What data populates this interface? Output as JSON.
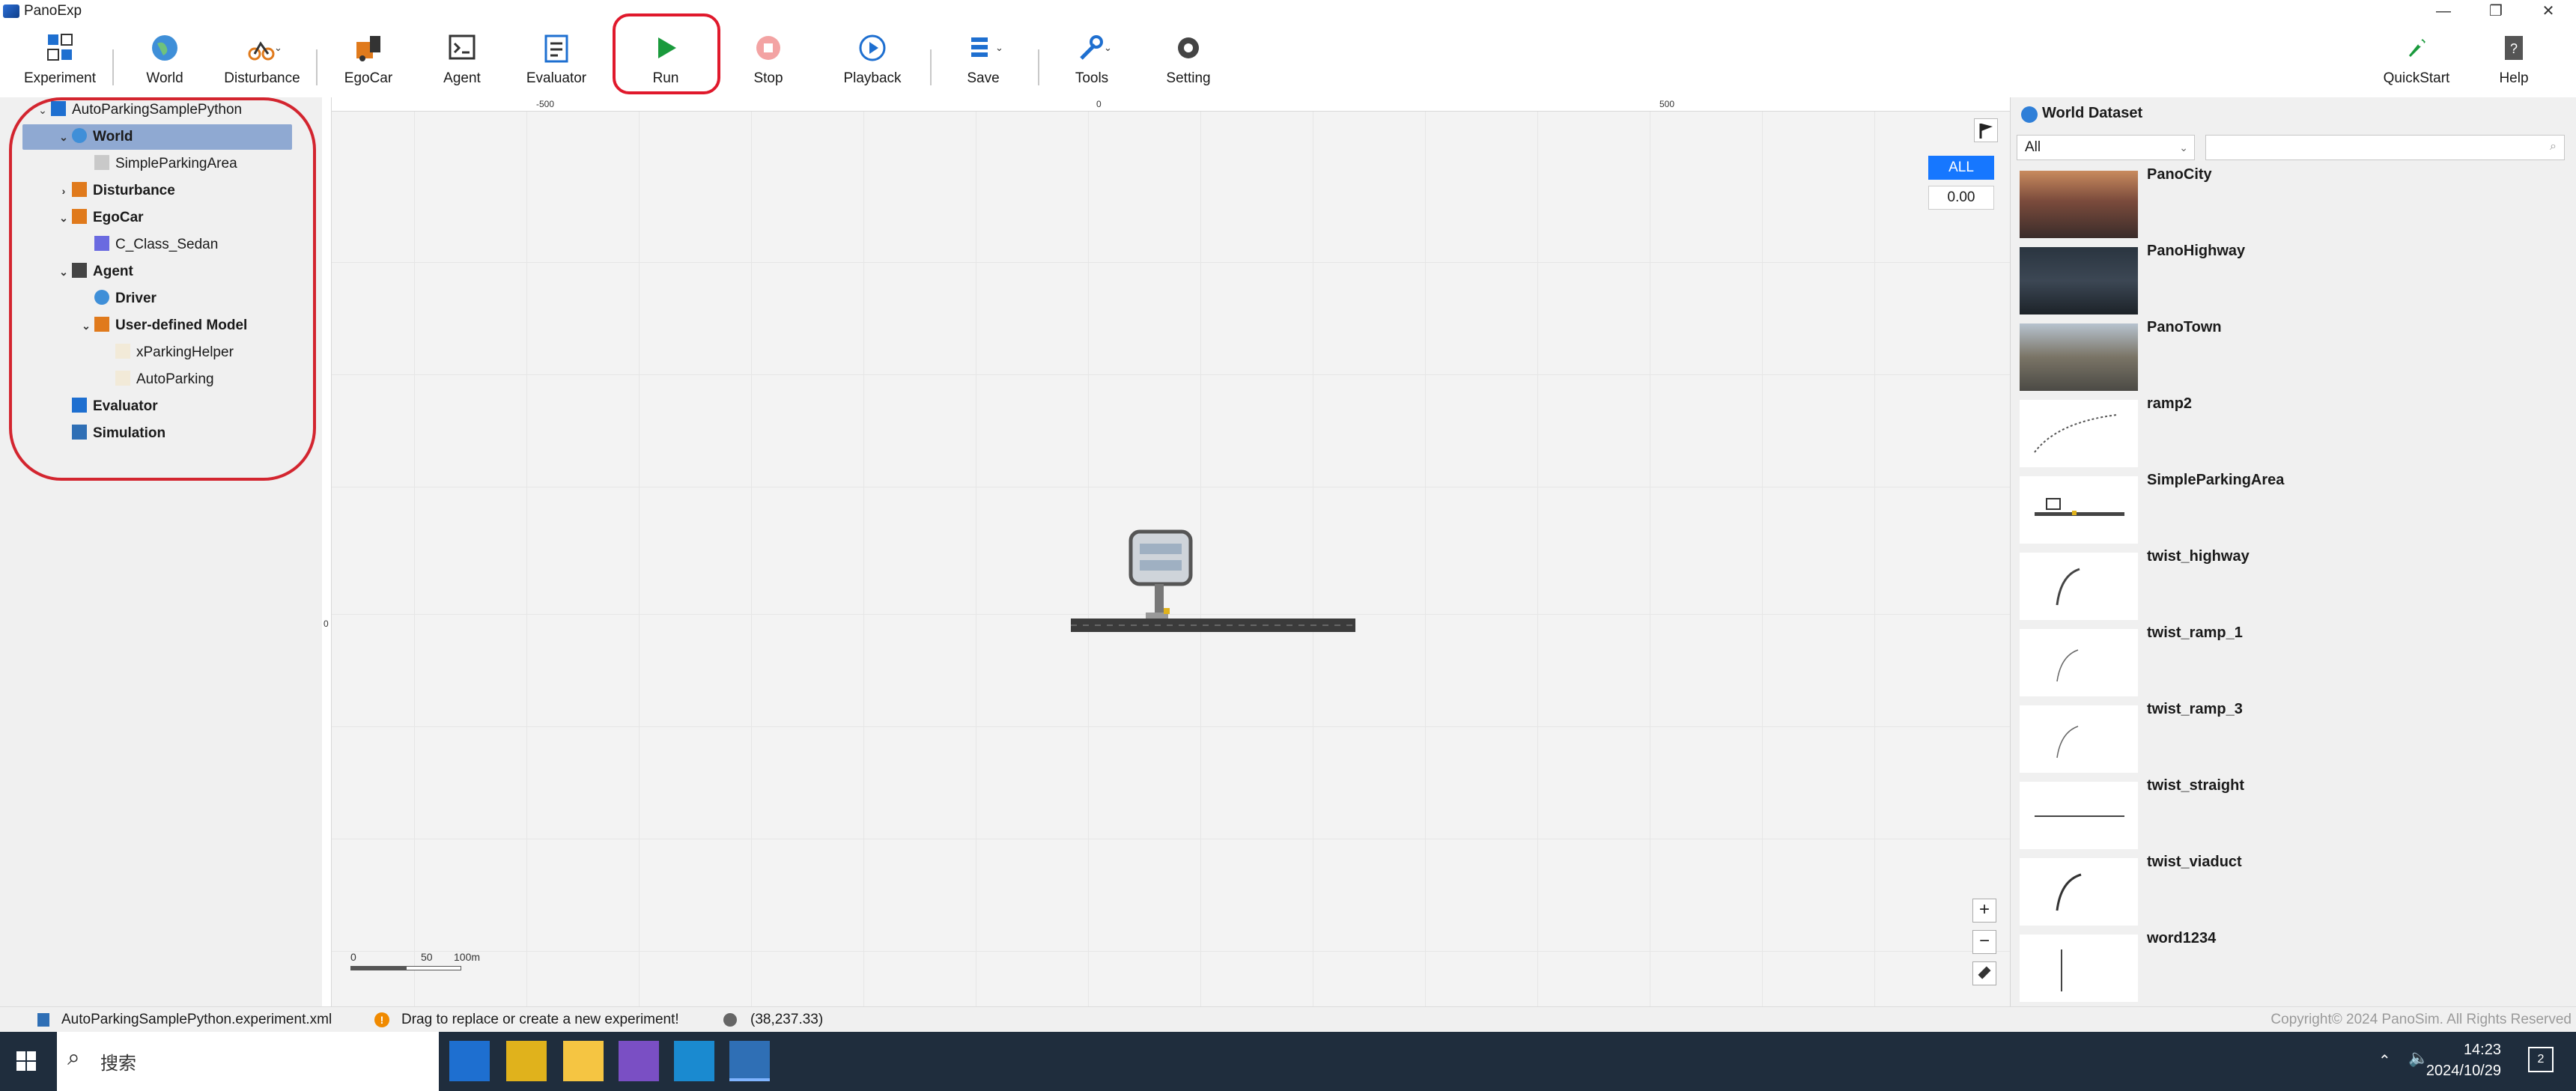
{
  "window": {
    "title": "PanoExp",
    "minimize": "—",
    "restore": "❐",
    "close": "✕"
  },
  "toolbar": {
    "experiment": "Experiment",
    "world": "World",
    "disturbance": "Disturbance",
    "egocar": "EgoCar",
    "agent": "Agent",
    "evaluator": "Evaluator",
    "run": "Run",
    "stop": "Stop",
    "playback": "Playback",
    "save": "Save",
    "tools": "Tools",
    "setting": "Setting",
    "quickstart": "QuickStart",
    "help": "Help",
    "highlight_color": "#e0192c"
  },
  "tree": {
    "root": "AutoParkingSamplePython",
    "world": "World",
    "world_child": "SimpleParkingArea",
    "disturbance": "Disturbance",
    "egocar": "EgoCar",
    "egocar_child": "C_Class_Sedan",
    "agent": "Agent",
    "driver": "Driver",
    "udm": "User-defined Model",
    "udm_child1": "xParkingHelper",
    "udm_child2": "AutoParking",
    "evaluator": "Evaluator",
    "simulation": "Simulation",
    "selected_color": "#8fa9d2"
  },
  "canvas": {
    "ruler_x": [
      "-500",
      "0",
      "500"
    ],
    "ruler_y": [
      "0"
    ],
    "all_button": "ALL",
    "zero_value": "0.00",
    "zoom_in": "+",
    "zoom_out": "−",
    "scale": {
      "start": "0",
      "mid": "50",
      "end": "100m"
    }
  },
  "dataset": {
    "title": "World Dataset",
    "filter": "All",
    "search_placeholder": "",
    "items": [
      "PanoCity",
      "PanoHighway",
      "PanoTown",
      "ramp2",
      "SimpleParkingArea",
      "twist_highway",
      "twist_ramp_1",
      "twist_ramp_3",
      "twist_straight",
      "twist_viaduct",
      "word1234"
    ]
  },
  "status": {
    "file": "AutoParkingSamplePython.experiment.xml",
    "message": "Drag to replace or create a new experiment!",
    "coords": "(38,237.33)",
    "copyright": "Copyright© 2024 PanoSim. All Rights Reserved"
  },
  "taskbar": {
    "search": "搜索",
    "time": "14:23",
    "date": "2024/10/29",
    "notifications": "2"
  }
}
